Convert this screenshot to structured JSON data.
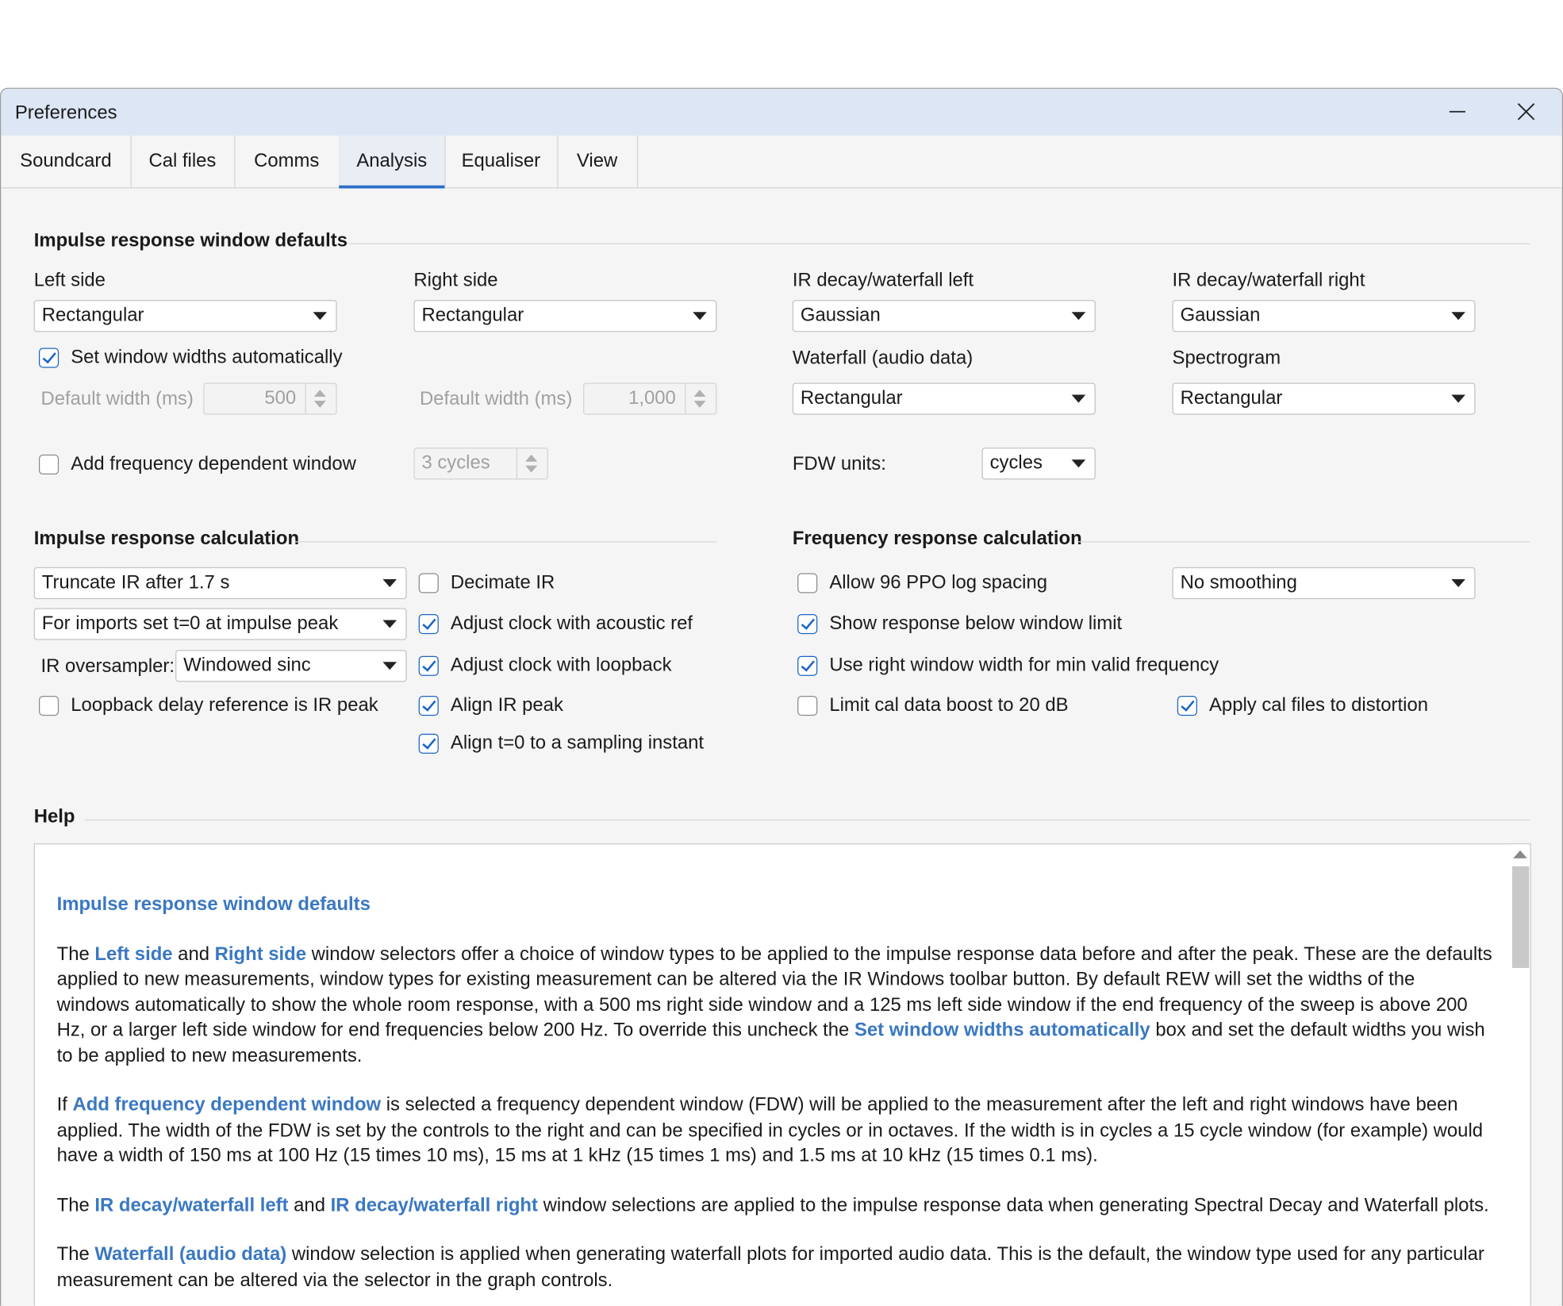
{
  "window": {
    "title": "Preferences",
    "minimize_icon": "minimize-icon",
    "close_icon": "close-icon"
  },
  "tabs": [
    {
      "label": "Soundcard"
    },
    {
      "label": "Cal files"
    },
    {
      "label": "Comms"
    },
    {
      "label": "Analysis",
      "selected": true
    },
    {
      "label": "Equaliser"
    },
    {
      "label": "View"
    }
  ],
  "ir_window": {
    "section_title": "Impulse response window defaults",
    "left_side_label": "Left side",
    "left_side_value": "Rectangular",
    "right_side_label": "Right side",
    "right_side_value": "Rectangular",
    "decay_left_label": "IR decay/waterfall left",
    "decay_left_value": "Gaussian",
    "decay_right_label": "IR decay/waterfall right",
    "decay_right_value": "Gaussian",
    "auto_widths_label": "Set window widths automatically",
    "auto_widths_checked": true,
    "waterfall_label": "Waterfall (audio data)",
    "waterfall_value": "Rectangular",
    "spectrogram_label": "Spectrogram",
    "spectrogram_value": "Rectangular",
    "left_default_width_label": "Default width (ms)",
    "left_default_width_value": "500",
    "right_default_width_label": "Default width (ms)",
    "right_default_width_value": "1,000",
    "fdw_label": "Add frequency dependent window",
    "fdw_checked": false,
    "fdw_cycles_value": "3 cycles",
    "fdw_units_label": "FDW units:",
    "fdw_units_value": "cycles"
  },
  "ir_calc": {
    "section_title": "Impulse response calculation",
    "truncate_value": "Truncate IR after 1.7 s",
    "imports_value": "For imports set t=0 at impulse peak",
    "oversampler_label": "IR oversampler:",
    "oversampler_value": "Windowed sinc",
    "loopback_delay_label": "Loopback delay reference is IR peak",
    "loopback_delay_checked": false,
    "decimate_label": "Decimate IR",
    "decimate_checked": false,
    "adjust_acoustic_label": "Adjust clock with acoustic ref",
    "adjust_acoustic_checked": true,
    "adjust_loopback_label": "Adjust clock with loopback",
    "adjust_loopback_checked": true,
    "align_peak_label": "Align IR peak",
    "align_peak_checked": true,
    "align_t0_label": "Align t=0 to a sampling instant",
    "align_t0_checked": true
  },
  "fr_calc": {
    "section_title": "Frequency response calculation",
    "allow96_label": "Allow 96 PPO log spacing",
    "allow96_checked": false,
    "smoothing_value": "No smoothing",
    "show_below_label": "Show response below window limit",
    "show_below_checked": true,
    "use_right_label": "Use right window width for min valid frequency",
    "use_right_checked": true,
    "limit_cal_label": "Limit cal data boost to 20 dB",
    "limit_cal_checked": false,
    "apply_cal_label": "Apply cal files to distortion",
    "apply_cal_checked": true
  },
  "help": {
    "section_title": "Help",
    "heading": "Impulse response window defaults",
    "p1": {
      "t1": "The ",
      "h1": "Left side",
      "t2": " and ",
      "h2": "Right side",
      "t3": " window selectors offer a choice of window types to be applied to the impulse response data before and after the peak. These are the defaults applied to new measurements, window types for existing measurement can be altered via the IR Windows toolbar button. By default REW will set the widths of the windows automatically to show the whole room response, with a 500 ms right side window and a 125 ms left side window if the end frequency of the sweep is above 200 Hz, or a larger left side window for end frequencies below 200 Hz. To override this uncheck the ",
      "h3": "Set window widths automatically",
      "t4": " box and set the default widths you wish to be applied to new measurements."
    },
    "p2": {
      "t1": "If ",
      "h1": "Add frequency dependent window",
      "t2": " is selected a frequency dependent window (FDW) will be applied to the measurement after the left and right windows have been applied. The width of the FDW is set by the controls to the right and can be specified in cycles or in octaves. If the width is in cycles a 15 cycle window (for example) would have a width of 150 ms at 100 Hz (15 times 10 ms), 15 ms at 1 kHz (15 times 1 ms) and 1.5 ms at 10 kHz (15 times 0.1 ms)."
    },
    "p3": {
      "t1": "The ",
      "h1": "IR decay/waterfall left",
      "t2": " and ",
      "h2": "IR decay/waterfall right",
      "t3": " window selections are applied to the impulse response data when generating Spectral Decay and Waterfall plots."
    },
    "p4": {
      "t1": "The ",
      "h1": "Waterfall (audio data)",
      "t2": " window selection is applied when generating waterfall plots for imported audio data. This is the default, the window type used for any particular measurement can be altered via the selector in the graph controls."
    }
  }
}
